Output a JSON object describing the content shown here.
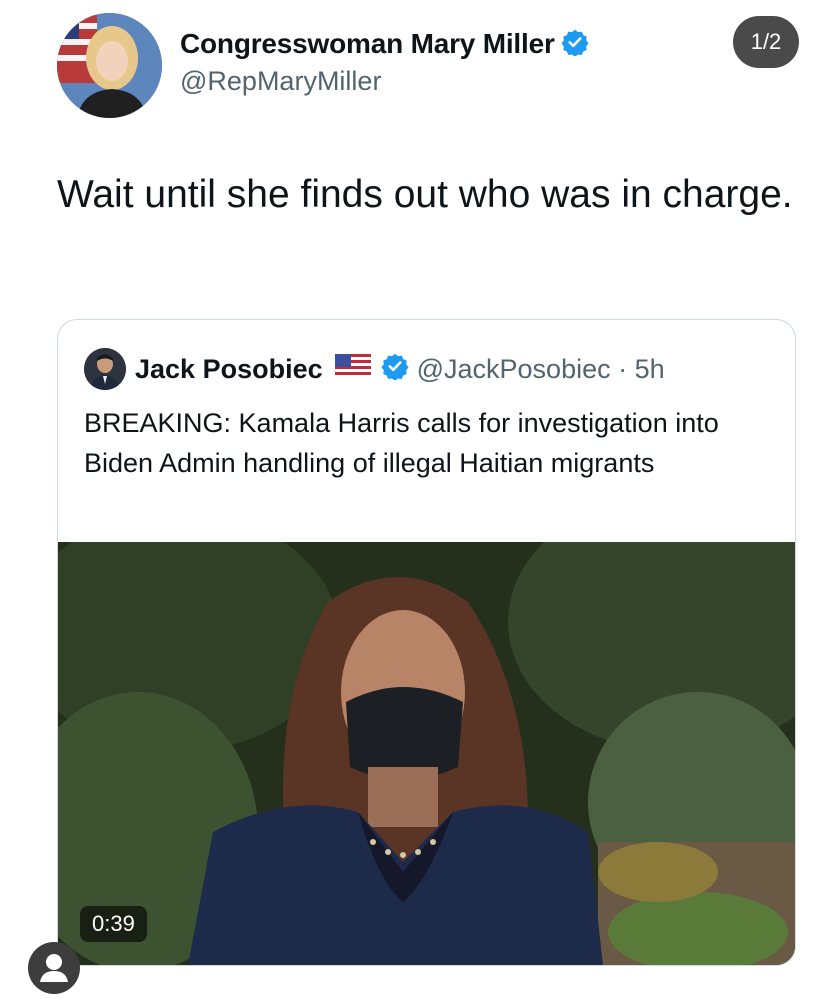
{
  "tweet": {
    "author_name": "Congresswoman Mary Miller",
    "handle": "@RepMaryMiller",
    "text": "Wait until she finds out who was in charge.",
    "page_indicator": "1/2"
  },
  "quoted": {
    "author_name": "Jack Posobiec",
    "handle_time": "@JackPosobiec · 5h",
    "text": "BREAKING: Kamala Harris calls for investigation into Biden Admin handling of illegal Haitian migrants",
    "video_duration": "0:39"
  },
  "icons": {
    "verified": "verified-badge-icon",
    "flag": "us-flag-icon",
    "user": "user-icon"
  },
  "colors": {
    "verified": "#1d9bf0",
    "secondary_text": "#536471",
    "card_border": "#cfd9de"
  }
}
